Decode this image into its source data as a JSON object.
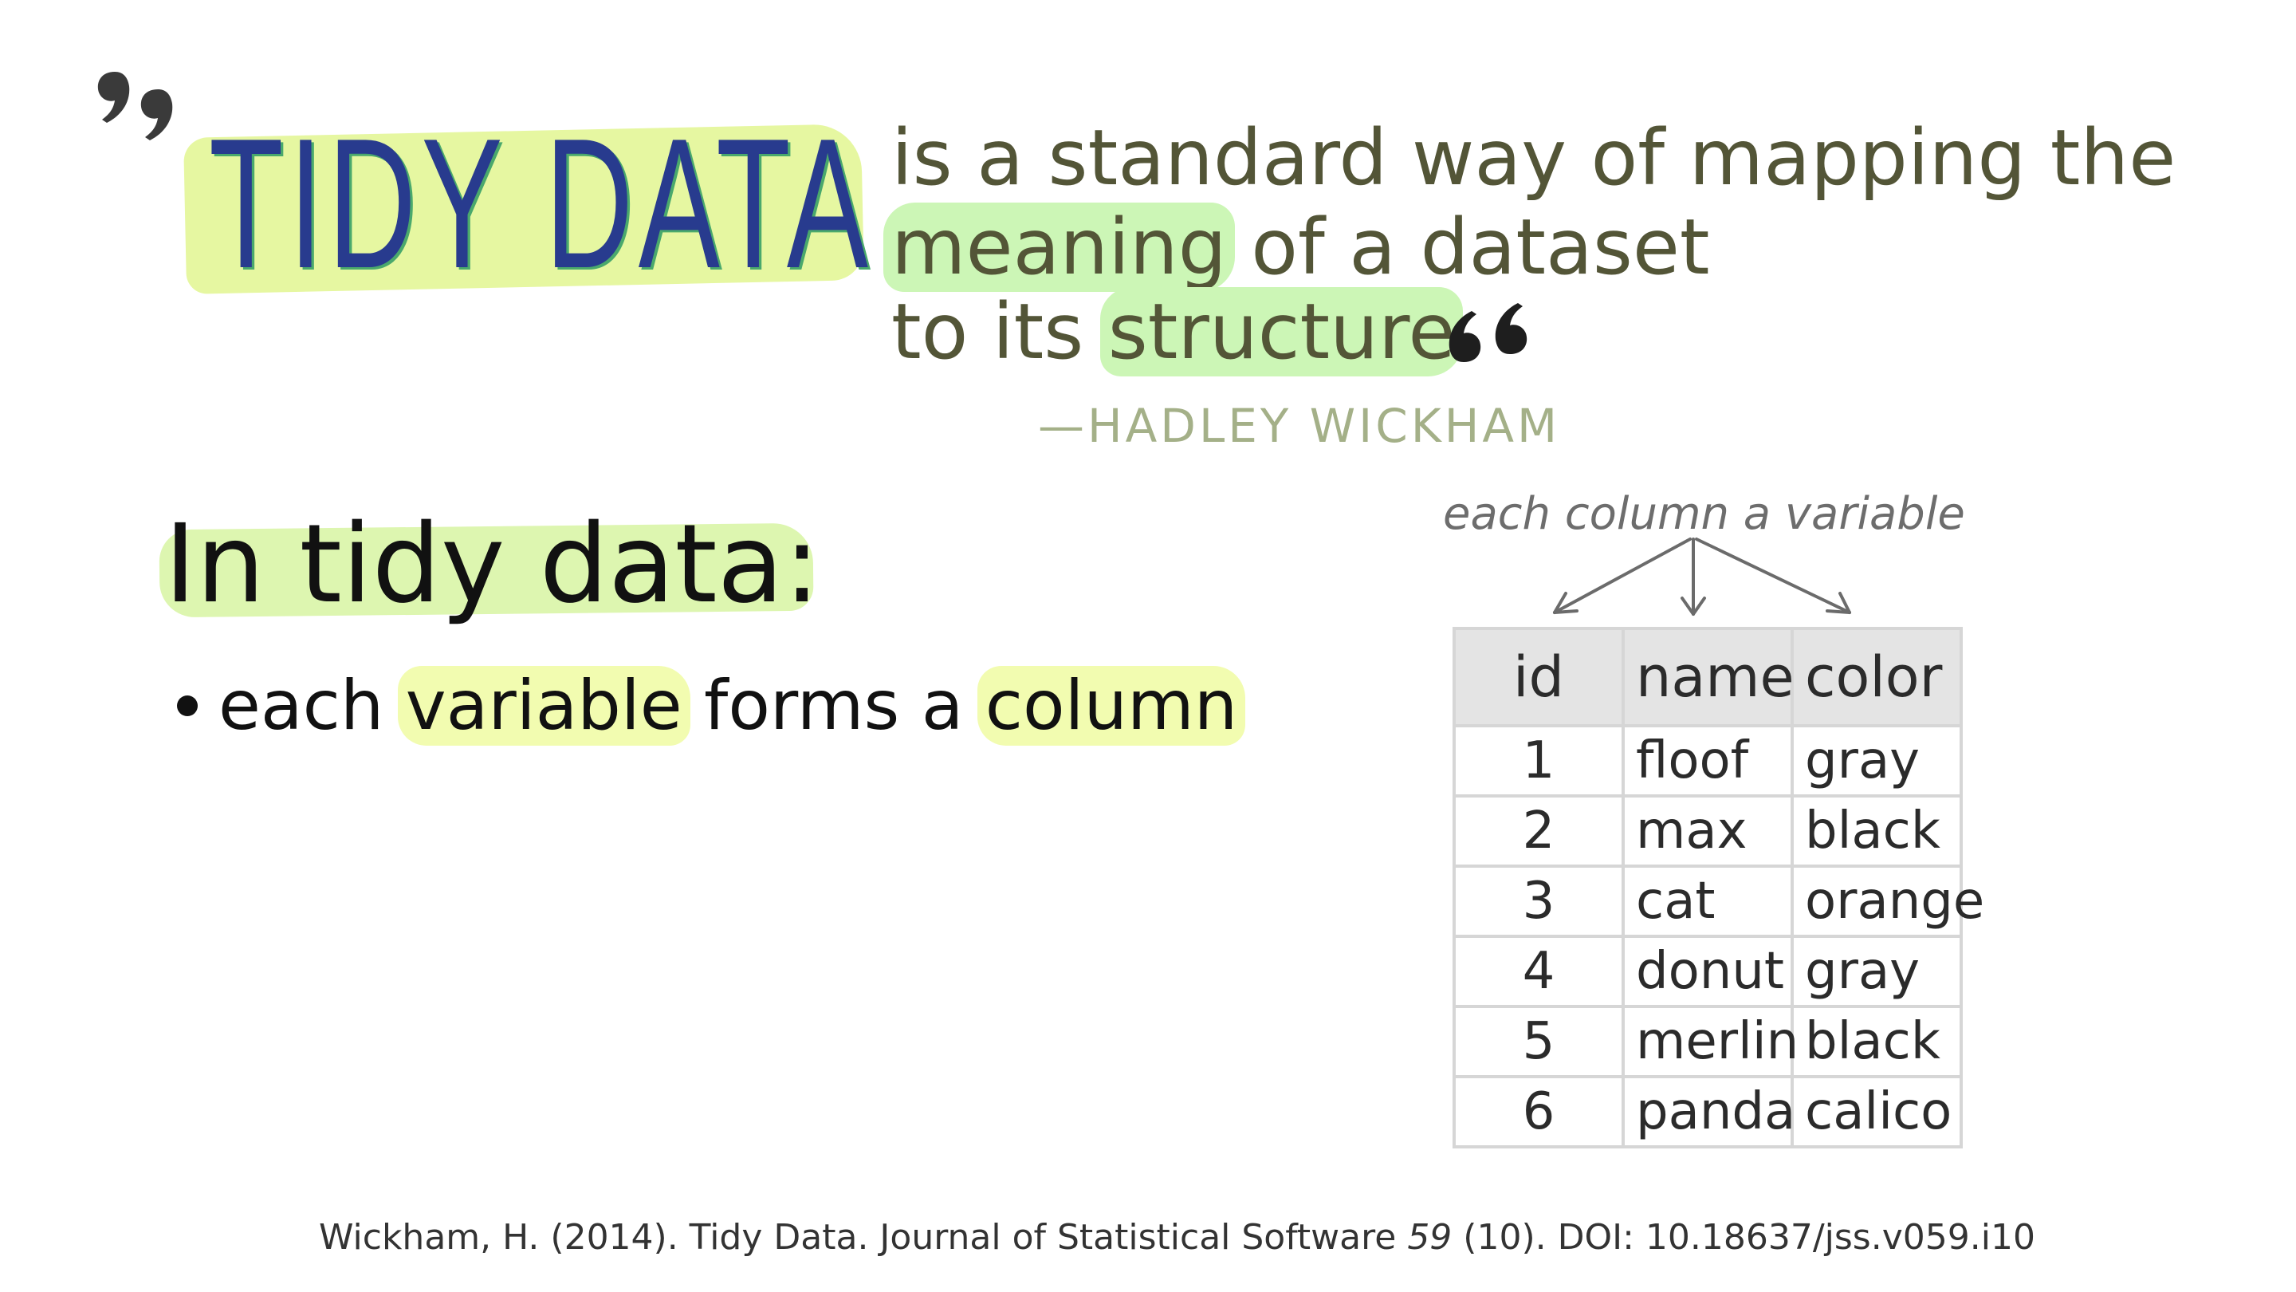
{
  "quote": {
    "title": "TIDY DATA",
    "line1": "is a standard way of mapping the",
    "line2_hl": "meaning",
    "line2_rest": " of a dataset",
    "line3_pre": "to its ",
    "line3_hl": "structure",
    "line3_end": ".",
    "author": "—HADLEY WICKHAM"
  },
  "principle": {
    "heading": "In tidy data:",
    "bullet_pre": "each ",
    "bullet_hl1": "variable",
    "bullet_mid": " forms a ",
    "bullet_hl2": "column"
  },
  "table_graphic": {
    "caption": "each column a variable",
    "headers": [
      "id",
      "name",
      "color"
    ],
    "rows": [
      [
        "1",
        "floof",
        "gray"
      ],
      [
        "2",
        "max",
        "black"
      ],
      [
        "3",
        "cat",
        "orange"
      ],
      [
        "4",
        "donut",
        "gray"
      ],
      [
        "5",
        "merlin",
        "black"
      ],
      [
        "6",
        "panda",
        "calico"
      ]
    ]
  },
  "citation": {
    "pre": "Wickham, H. (2014). Tidy Data. Journal of Statistical Software ",
    "volume": "59",
    "post": " (10). DOI: 10.18637/jss.v059.i10"
  },
  "colors": {
    "title_blue": "#283b8e",
    "title_green_outline": "#4aa96c",
    "yellow_highlight": "#e6f7a1",
    "green_highlight": "#ccf6b6",
    "quote_text": "#535537"
  }
}
